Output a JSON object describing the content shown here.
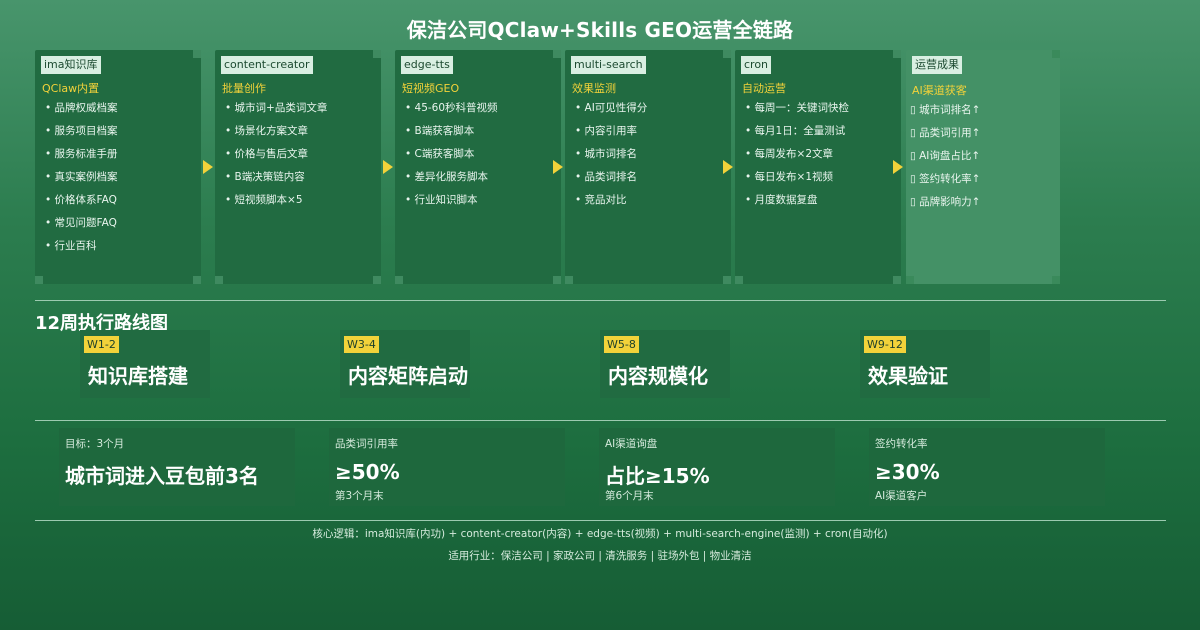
{
  "title": "保洁公司QClaw+Skills GEO运营全链路",
  "pipeline": [
    {
      "tool": "ima知识库",
      "subtitle": "QClaw内置",
      "items": [
        "• 品牌权威档案",
        "• 服务项目档案",
        "• 服务标准手册",
        "• 真实案例档案",
        "• 价格体系FAQ",
        "• 常见问题FAQ",
        "• 行业百科"
      ]
    },
    {
      "tool": "content-creator",
      "subtitle": "批量创作",
      "items": [
        "• 城市词+品类词文章",
        "• 场景化方案文章",
        "• 价格与售后文章",
        "• B端决策链内容",
        "• 短视频脚本×5"
      ]
    },
    {
      "tool": "edge-tts",
      "subtitle": "短视频GEO",
      "items": [
        "• 45-60秒科普视频",
        "• B端获客脚本",
        "• C端获客脚本",
        "• 差异化服务脚本",
        "• 行业知识脚本"
      ]
    },
    {
      "tool": "multi-search",
      "subtitle": "效果监测",
      "items": [
        "• AI可见性得分",
        "• 内容引用率",
        "• 城市词排名",
        "• 品类词排名",
        "• 竞品对比"
      ]
    },
    {
      "tool": "cron",
      "subtitle": "自动运营",
      "items": [
        "• 每周一：关键词快检",
        "• 每月1日：全量测试",
        "• 每周发布×2文章",
        "• 每日发布×1视频",
        "• 月度数据复盘"
      ]
    }
  ],
  "result": {
    "label": "运营成果",
    "subtitle": "AI渠道获客",
    "items": [
      "▯ 城市词排名↑",
      "▯ 品类词引用↑",
      "▯ AI询盘占比↑",
      "▯ 签约转化率↑",
      "▯ 品牌影响力↑"
    ]
  },
  "roadmap": {
    "title": "12周执行路线图",
    "phases": [
      {
        "tag": "W1-2",
        "name": "知识库搭建"
      },
      {
        "tag": "W3-4",
        "name": "内容矩阵启动"
      },
      {
        "tag": "W5-8",
        "name": "内容规模化"
      },
      {
        "tag": "W9-12",
        "name": "效果验证"
      }
    ]
  },
  "metrics": [
    {
      "label": "目标：3个月",
      "value": "城市词进入豆包前3名",
      "note": ""
    },
    {
      "label": "品类词引用率",
      "value": "≥50%",
      "note": "第3个月末"
    },
    {
      "label": "AI渠道询盘",
      "value": "占比≥15%",
      "note": "第6个月末"
    },
    {
      "label": "签约转化率",
      "value": "≥30%",
      "note": "AI渠道客户"
    }
  ],
  "footer": {
    "logic": "核心逻辑：ima知识库(内功) + content-creator(内容) + edge-tts(视频) + multi-search-engine(监测) + cron(自动化)",
    "industries": "适用行业：保洁公司 | 家政公司 | 清洗服务 | 驻场外包 | 物业清洁"
  },
  "colors": {
    "accent": "#f2d23a",
    "card": "#216b41",
    "result_card": "#449166"
  }
}
